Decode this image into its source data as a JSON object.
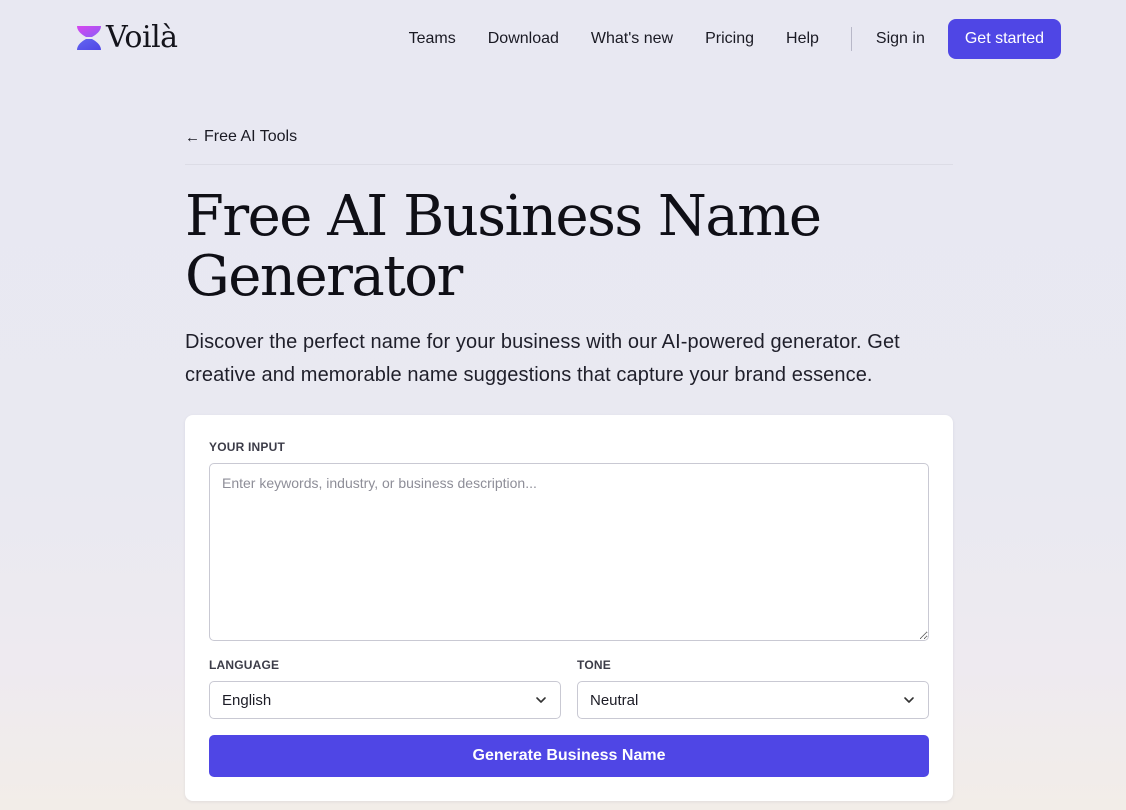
{
  "header": {
    "logo_text": "Voilà",
    "nav": [
      "Teams",
      "Download",
      "What's new",
      "Pricing",
      "Help"
    ],
    "sign_in": "Sign in",
    "cta": "Get started"
  },
  "page": {
    "back_link": "Free AI Tools",
    "title_line1": "Free AI Business Name",
    "title_line2": "Generator",
    "subtitle_line1": "Discover the perfect name for your business with our AI-powered generator. Get",
    "subtitle_line2": "creative and memorable name suggestions that capture your brand essence."
  },
  "form": {
    "input_label": "YOUR INPUT",
    "input_placeholder": "Enter keywords, industry, or business description...",
    "input_value": "",
    "language_label": "LANGUAGE",
    "language_value": "English",
    "tone_label": "TONE",
    "tone_value": "Neutral",
    "submit_label": "Generate Business Name"
  },
  "colors": {
    "accent": "#4f46e5",
    "background": "#e8e8f2",
    "card": "#ffffff"
  },
  "icons": {
    "logo": "hourglass-logo-icon",
    "back": "arrow-left-icon",
    "select": "chevron-down-icon"
  }
}
